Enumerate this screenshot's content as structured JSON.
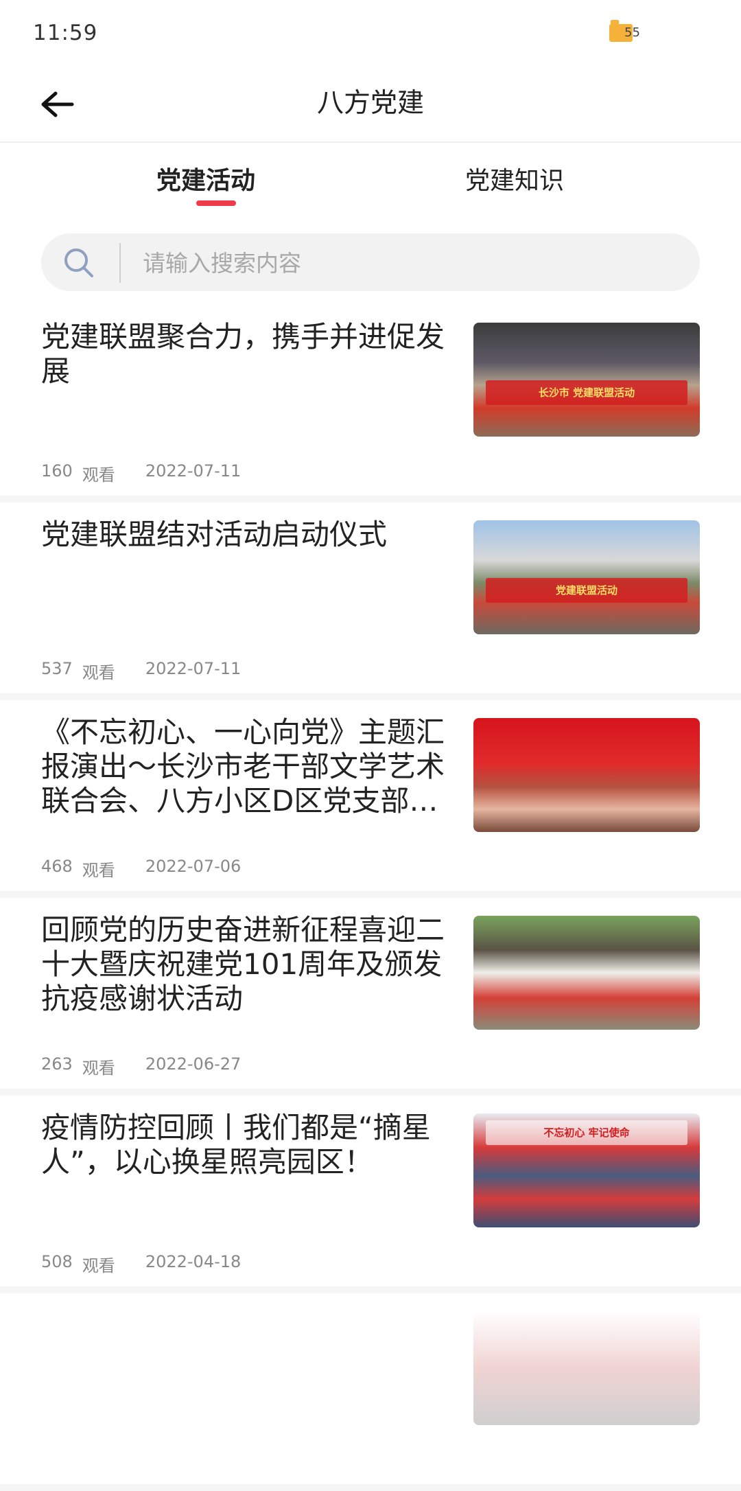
{
  "status_bar": {
    "time": "11:59",
    "battery": "55"
  },
  "header": {
    "title": "八方党建"
  },
  "tabs": [
    {
      "label": "党建活动"
    },
    {
      "label": "党建知识"
    }
  ],
  "search": {
    "placeholder": "请输入搜索内容",
    "value": ""
  },
  "articles": [
    {
      "title": "党建联盟聚合力，携手并进促发展",
      "views": "160",
      "views_label": "观看",
      "date": "2022-07-11",
      "thumb_text": "长沙市 党建联盟活动"
    },
    {
      "title": "党建联盟结对活动启动仪式",
      "views": "537",
      "views_label": "观看",
      "date": "2022-07-11",
      "thumb_text": "党建联盟活动"
    },
    {
      "title": "《不忘初心、一心向党》主题汇报演出～长沙市老干部文学艺术联合会、八方小区D区党支部联合开展",
      "views": "468",
      "views_label": "观看",
      "date": "2022-07-06",
      "thumb_text": ""
    },
    {
      "title": "回顾党的历史奋进新征程喜迎二十大暨庆祝建党101周年及颁发抗疫感谢状活动",
      "views": "263",
      "views_label": "观看",
      "date": "2022-06-27",
      "thumb_text": ""
    },
    {
      "title": "疫情防控回顾丨我们都是“摘星人”，以心换星照亮园区！",
      "views": "508",
      "views_label": "观看",
      "date": "2022-04-18",
      "thumb_text": "不忘初心 牢记使命"
    }
  ],
  "colors": {
    "accent": "#ee3b4a",
    "meta": "#888888"
  }
}
